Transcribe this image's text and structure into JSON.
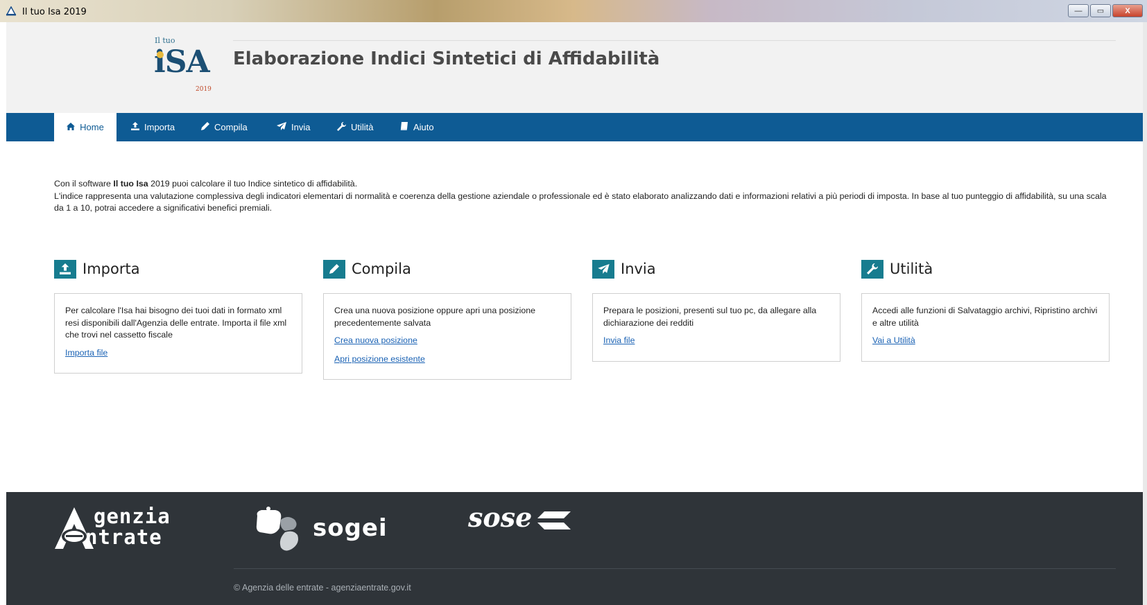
{
  "window": {
    "title": "Il tuo Isa 2019",
    "minimize_glyph": "—",
    "maximize_glyph": "▭",
    "close_glyph": "X"
  },
  "header": {
    "logo_small": "Il tuo",
    "logo_big": "iSA",
    "logo_year": "2019",
    "title": "Elaborazione Indici Sintetici di Affidabilità"
  },
  "nav": {
    "items": [
      {
        "label": "Home",
        "icon": "home-icon"
      },
      {
        "label": "Importa",
        "icon": "upload-icon"
      },
      {
        "label": "Compila",
        "icon": "pencil-icon"
      },
      {
        "label": "Invia",
        "icon": "send-icon"
      },
      {
        "label": "Utilità",
        "icon": "wrench-icon"
      },
      {
        "label": "Aiuto",
        "icon": "book-icon"
      }
    ],
    "active": "Home"
  },
  "intro": {
    "line1_pre": "Con il software ",
    "line1_bold": "Il tuo Isa",
    "line1_post": " 2019 puoi calcolare il tuo Indice sintetico di affidabilità.",
    "line2": "L'indice rappresenta una valutazione complessiva degli indicatori elementari di normalità e coerenza della gestione aziendale o professionale ed è stato elaborato analizzando dati e informazioni relativi a più periodi di imposta. In base al tuo punteggio di affidabilità, su una scala da 1 a 10, potrai accedere a significativi benefici premiali."
  },
  "sections": {
    "importa": {
      "title": "Importa",
      "text": "Per calcolare l'Isa hai bisogno dei tuoi dati in formato xml resi disponibili dall'Agenzia delle entrate. Importa il file xml che trovi nel cassetto fiscale",
      "link1": "Importa file"
    },
    "compila": {
      "title": "Compila",
      "text": "Crea una nuova posizione oppure apri una posizione precedentemente salvata",
      "link1": "Crea nuova posizione",
      "link2": "Apri posizione esistente"
    },
    "invia": {
      "title": "Invia",
      "text": "Prepara le posizioni, presenti sul tuo pc, da allegare alla dichiarazione dei redditi",
      "link1": "Invia file"
    },
    "utilita": {
      "title": "Utilità",
      "text": "Accedi alle funzioni di Salvataggio archivi, Ripristino archivi e altre utilità",
      "link1": "Vai a Utilità"
    }
  },
  "footer": {
    "agenzia_line1": "genzia",
    "agenzia_line2": "ntrate",
    "sogei": "sogei",
    "sose": "sose",
    "copyright": "© Agenzia delle entrate - agenziaentrate.gov.it"
  },
  "colors": {
    "nav_bg": "#0e5b94",
    "section_icon_bg": "#177c8f",
    "link": "#1a62b4",
    "footer_bg": "#2f3439"
  }
}
